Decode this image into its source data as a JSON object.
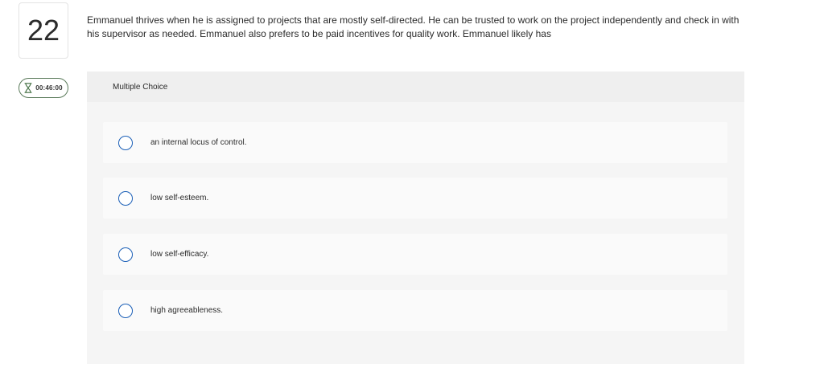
{
  "question": {
    "number": "22",
    "prompt": "Emmanuel thrives when he is assigned to projects that are mostly self-directed. He can be trusted to work on the project independently and check in with his supervisor as needed. Emmanuel also prefers to be paid incentives for quality work. Emmanuel likely has"
  },
  "timer": {
    "icon": "hourglass-icon",
    "value": "00:46:00",
    "border_color": "#5a7a5a"
  },
  "panel": {
    "header": "Multiple Choice"
  },
  "options": [
    {
      "label": "an internal locus of control."
    },
    {
      "label": "low self-esteem."
    },
    {
      "label": "low self-efficacy."
    },
    {
      "label": "high agreeableness."
    }
  ],
  "colors": {
    "radio_border": "#1b5fb7",
    "panel_bg": "#f5f5f5",
    "option_bg": "#fafafa"
  }
}
